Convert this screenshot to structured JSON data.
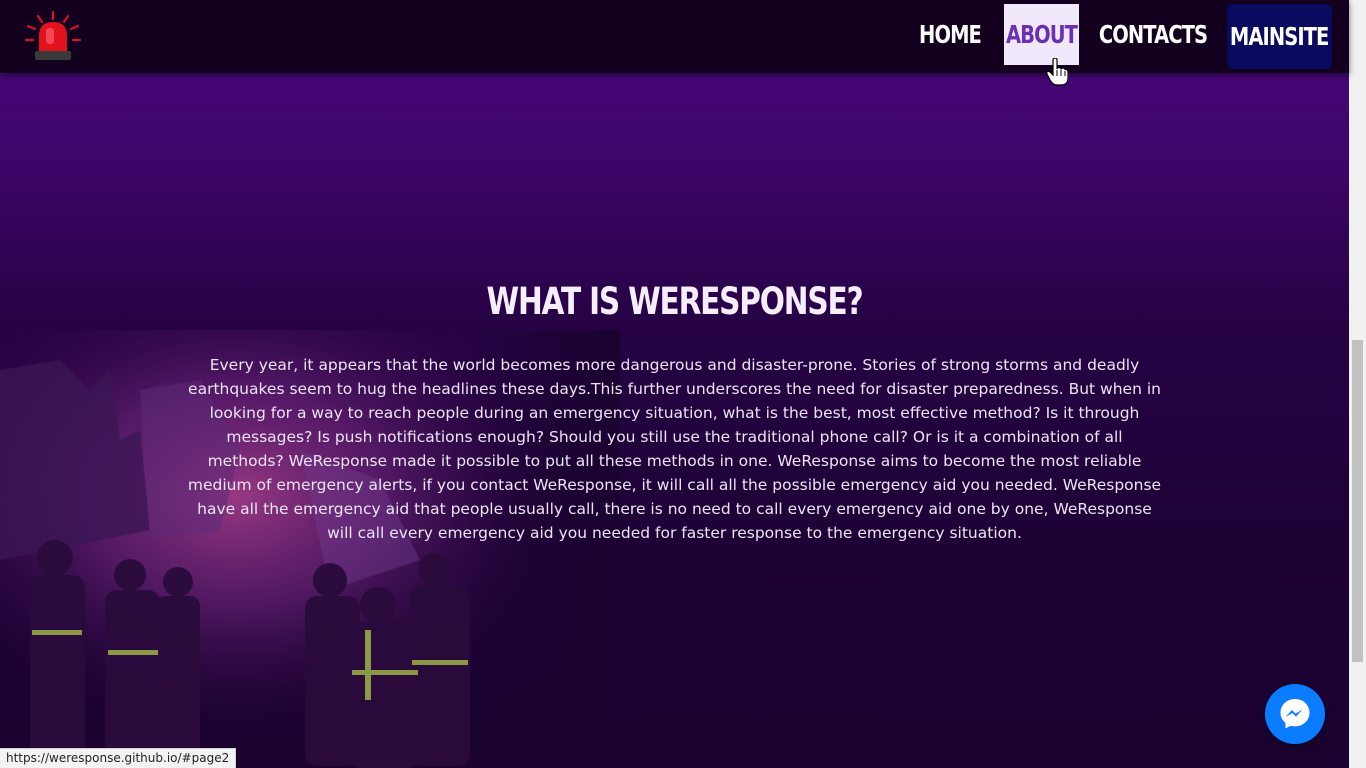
{
  "nav": {
    "home": "HOME",
    "about": "ABOUT",
    "contacts": "CONTACTS",
    "mainsite": "MAINSITE"
  },
  "section": {
    "title": "WHAT IS WERESPONSE?",
    "body": "Every year, it appears that the world becomes more dangerous and disaster-prone. Stories of strong storms and deadly earthquakes seem to hug the headlines these days.This further underscores the need for disaster preparedness. But when in looking for a way to reach people during an emergency situation, what is the best, most effective method? Is it through messages? Is push notifications enough? Should you still use the traditional phone call? Or is it a combination of all methods? WeResponse made it possible to put all these methods in one. WeResponse aims to become the most reliable medium of emergency alerts, if you contact WeResponse, it will call all the possible emergency aid you needed. WeResponse have all the emergency aid that people usually call, there is no need to call every emergency aid one by one, WeResponse will call every emergency aid you needed for faster response to the emergency situation."
  },
  "status_url": "https://weresponse.github.io/#page2",
  "icons": {
    "logo": "siren-icon",
    "messenger": "messenger-icon",
    "cursor": "hand-pointer-icon"
  },
  "colors": {
    "header_bg": "#13001f",
    "active_tab_bg": "#f1e8fb",
    "active_tab_text": "#6b2fb3",
    "mainsite_bg": "#0a0a5e",
    "messenger_blue": "#0a7cff"
  }
}
